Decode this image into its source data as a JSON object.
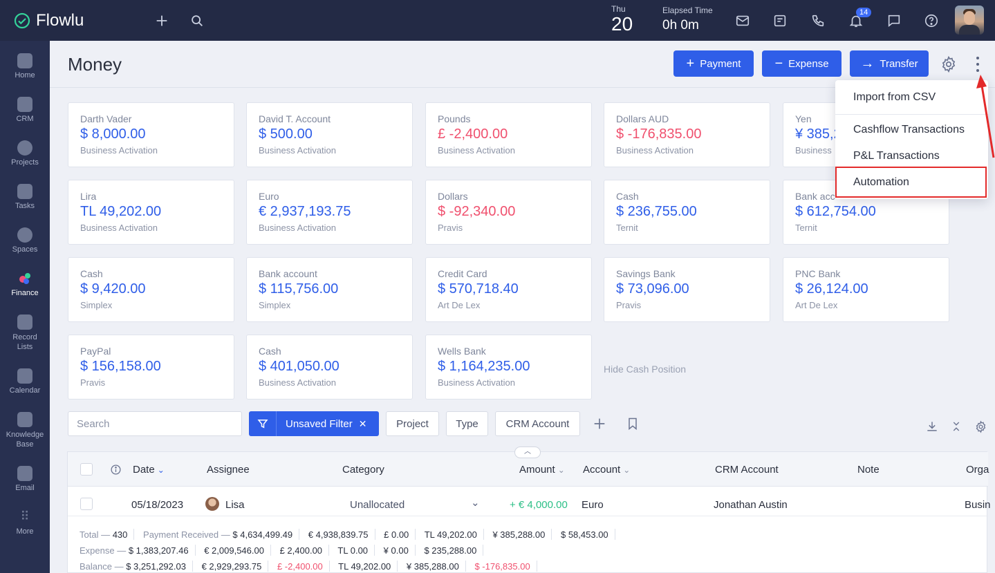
{
  "app": {
    "name": "Flowlu"
  },
  "topbar": {
    "date_dow": "Thu",
    "date_day": "20",
    "elapsed_label": "Elapsed Time",
    "elapsed_value": "0h 0m",
    "notif_count": "14"
  },
  "sidebar": {
    "items": [
      {
        "label": "Home"
      },
      {
        "label": "CRM"
      },
      {
        "label": "Projects"
      },
      {
        "label": "Tasks"
      },
      {
        "label": "Spaces"
      },
      {
        "label": "Finance"
      },
      {
        "label": "Record Lists"
      },
      {
        "label": "Calendar"
      },
      {
        "label": "Knowledge Base"
      },
      {
        "label": "Email"
      },
      {
        "label": "More"
      }
    ]
  },
  "page": {
    "title": "Money",
    "btn_payment": "Payment",
    "btn_expense": "Expense",
    "btn_transfer": "Transfer"
  },
  "dropdown": {
    "items": [
      "Import from CSV",
      "Cashflow Transactions",
      "P&L Transactions",
      "Automation"
    ]
  },
  "accounts": [
    {
      "name": "Darth Vader",
      "amount": "$ 8,000.00",
      "org": "Business Activation"
    },
    {
      "name": "David T. Account",
      "amount": "$ 500.00",
      "org": "Business Activation"
    },
    {
      "name": "Pounds",
      "amount": "£ -2,400.00",
      "org": "Business Activation"
    },
    {
      "name": "Dollars AUD",
      "amount": "$ -176,835.00",
      "org": "Business Activation"
    },
    {
      "name": "Yen",
      "amount": "¥ 385,2",
      "org": "Business"
    },
    {
      "name": "Lira",
      "amount": "TL 49,202.00",
      "org": "Business Activation"
    },
    {
      "name": "Euro",
      "amount": "€ 2,937,193.75",
      "org": "Business Activation"
    },
    {
      "name": "Dollars",
      "amount": "$ -92,340.00",
      "org": "Pravis"
    },
    {
      "name": "Cash",
      "amount": "$ 236,755.00",
      "org": "Ternit"
    },
    {
      "name": "Bank acc",
      "amount": "$ 612,754.00",
      "org": "Ternit"
    },
    {
      "name": "Cash",
      "amount": "$ 9,420.00",
      "org": "Simplex"
    },
    {
      "name": "Bank account",
      "amount": "$ 115,756.00",
      "org": "Simplex"
    },
    {
      "name": "Credit Card",
      "amount": "$ 570,718.40",
      "org": "Art De Lex"
    },
    {
      "name": "Savings Bank",
      "amount": "$ 73,096.00",
      "org": "Pravis"
    },
    {
      "name": "PNC Bank",
      "amount": "$ 26,124.00",
      "org": "Art De Lex"
    },
    {
      "name": "PayPal",
      "amount": "$ 156,158.00",
      "org": "Pravis"
    },
    {
      "name": "Cash",
      "amount": "$ 401,050.00",
      "org": "Business Activation"
    },
    {
      "name": "Wells Bank",
      "amount": "$ 1,164,235.00",
      "org": "Business Activation"
    }
  ],
  "hide_cash_label": "Hide Cash Position",
  "filters": {
    "search_placeholder": "Search",
    "unsaved_filter": "Unsaved Filter",
    "chips": [
      "Project",
      "Type",
      "CRM Account"
    ]
  },
  "table": {
    "columns": [
      "Date",
      "Assignee",
      "Category",
      "Amount",
      "Account",
      "CRM Account",
      "Note",
      "Orga"
    ],
    "rows": [
      {
        "date": "05/18/2023",
        "assignee": "Lisa",
        "category": "Unallocated",
        "amount": "+ € 4,000.00",
        "account": "Euro",
        "crm_account": "Jonathan Austin",
        "org": "Busin"
      }
    ]
  },
  "totals": {
    "total_label": "Total —",
    "total_count": "430",
    "payment_label": "Payment Received —",
    "payment_values": [
      "$ 4,634,499.49",
      "€ 4,938,839.75",
      "£ 0.00",
      "TL 49,202.00",
      "¥ 385,288.00",
      "$ 58,453.00"
    ],
    "expense_label": "Expense —",
    "expense_values": [
      "$ 1,383,207.46",
      "€ 2,009,546.00",
      "£ 2,400.00",
      "TL 0.00",
      "¥ 0.00",
      "$ 235,288.00"
    ],
    "balance_label": "Balance —",
    "balance_values": [
      "$ 3,251,292.03",
      "€ 2,929,293.75",
      "£ -2,400.00",
      "TL 49,202.00",
      "¥ 385,288.00",
      "$ -176,835.00"
    ]
  }
}
